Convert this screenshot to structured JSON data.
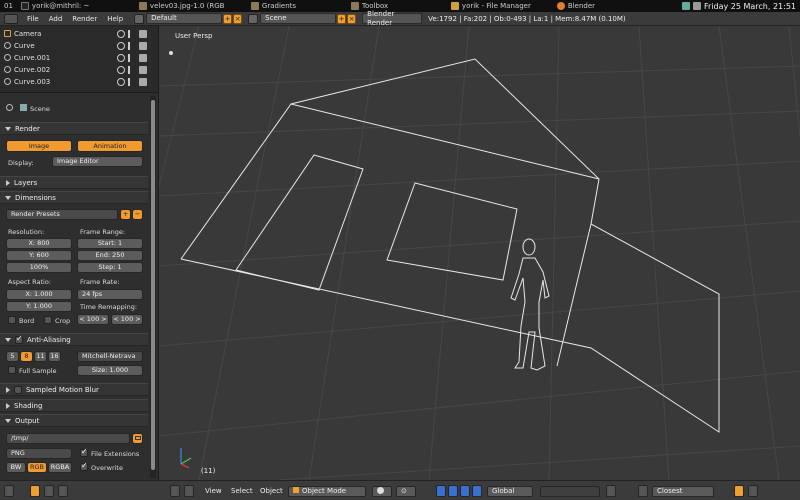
{
  "taskbar": {
    "workspace": "01",
    "items": [
      {
        "label": "yorik@mithril: ~",
        "icon": "terminal-icon"
      },
      {
        "label": "velev03.jpg-1.0 (RGB",
        "icon": "gimp-icon"
      },
      {
        "label": "Gradients",
        "icon": "gimp-icon"
      },
      {
        "label": "Toolbox",
        "icon": "gimp-icon"
      },
      {
        "label": "yorik - File Manager",
        "icon": "folder-icon"
      },
      {
        "label": "Blender",
        "icon": "blender-icon"
      }
    ],
    "clock": "Friday 25 March, 21:51"
  },
  "info_header": {
    "menus": [
      "File",
      "Add",
      "Render",
      "Help"
    ],
    "screen": "Default",
    "scene": "Scene",
    "engine": "Blender Render",
    "stats": "Ve:1792 | Fa:202 | Ob:0-493 | La:1 | Mem:8.47M (0.10M)"
  },
  "outliner": {
    "items": [
      "Camera",
      "Curve",
      "Curve.001",
      "Curve.002",
      "Curve.003"
    ]
  },
  "properties": {
    "context": "Scene",
    "render": {
      "title": "Render",
      "image_btn": "Image",
      "animation_btn": "Animation",
      "display_label": "Display:",
      "display_value": "Image Editor"
    },
    "layers_title": "Layers",
    "dimensions": {
      "title": "Dimensions",
      "presets": "Render Presets",
      "resolution_label": "Resolution:",
      "res_x": "X: 800",
      "res_y": "Y: 600",
      "res_pct": "100%",
      "frame_range_label": "Frame Range:",
      "start": "Start: 1",
      "end": "End: 250",
      "step": "Step: 1",
      "aspect_label": "Aspect Ratio:",
      "asp_x": "X: 1.000",
      "asp_y": "Y: 1.000",
      "frame_rate_label": "Frame Rate:",
      "fps": "24 fps",
      "time_remap_label": "Time Remapping:",
      "remap_old": "< 100 >",
      "remap_new": "< 100 >",
      "bord": "Bord",
      "crop": "Crop"
    },
    "aa": {
      "title": "Anti-Aliasing",
      "samples": [
        "5",
        "8",
        "11",
        "16"
      ],
      "selected_sample": "8",
      "filter": "Mitchell-Netrava",
      "full_sample": "Full Sample",
      "size": "Size: 1.000"
    },
    "motion_blur_title": "Sampled Motion Blur",
    "shading_title": "Shading",
    "output": {
      "title": "Output",
      "path": "/tmp/",
      "format": "PNG",
      "file_ext": "File Extensions",
      "bw": "BW",
      "rgb": "RGB",
      "rgba": "RGBA",
      "overwrite": "Overwrite"
    }
  },
  "viewport": {
    "label": "User Persp",
    "frame": "(11)"
  },
  "bottom_header": {
    "menus": [
      "View",
      "Select",
      "Object"
    ],
    "mode": "Object Mode",
    "orientation": "Global",
    "snap": "Closest"
  },
  "colors": {
    "accent": "#f0a030",
    "viewport_bg": "#393939",
    "grid": "#474747",
    "wire": "#e8e8e8"
  }
}
